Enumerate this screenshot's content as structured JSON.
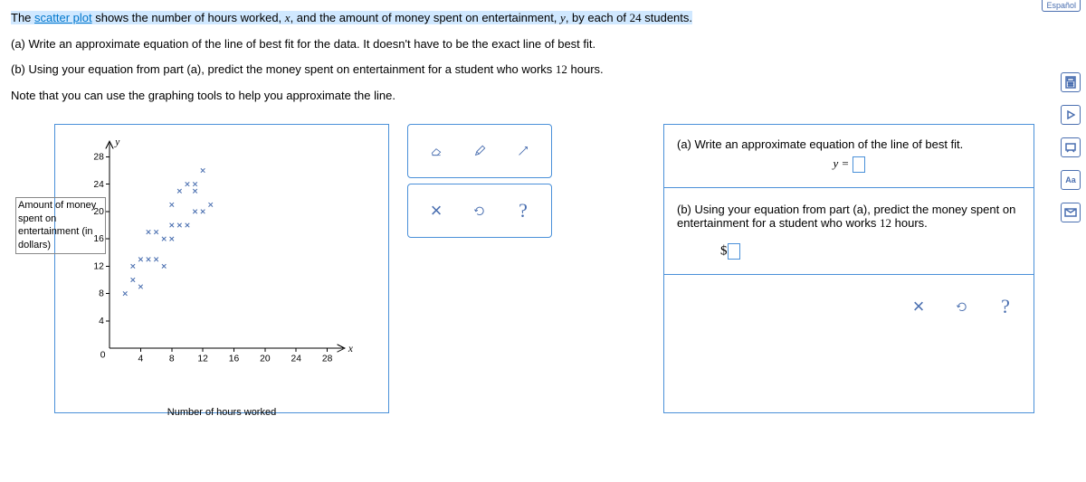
{
  "espanol": "Español",
  "question": {
    "intro_pre": "The ",
    "scatter_link": "scatter plot",
    "intro_mid1": " shows the number of hours worked, ",
    "var_x": "x",
    "intro_mid2": ", and the amount of money spent on entertainment, ",
    "var_y": "y",
    "intro_mid3": ", by each of ",
    "student_count": "24",
    "intro_end": " students.",
    "part_a": "(a) Write an approximate equation of the line of best fit for the data. It doesn't have to be the exact line of best fit.",
    "part_b_pre": "(b) Using your equation from part (a), predict the money spent on entertainment for a student who works ",
    "part_b_hours": "12",
    "part_b_post": " hours.",
    "note": "Note that you can use the graphing tools to help you approximate the line."
  },
  "chart": {
    "y_axis_name": "y",
    "x_axis_name": "x",
    "ylabel": "Amount of money spent on entertainment (in dollars)",
    "xlabel": "Number of hours worked",
    "origin": "0",
    "x_ticks": [
      "4",
      "8",
      "12",
      "16",
      "20",
      "24",
      "28"
    ],
    "y_ticks": [
      "4",
      "8",
      "12",
      "16",
      "20",
      "24",
      "28"
    ]
  },
  "chart_data": {
    "type": "scatter",
    "xlabel": "Number of hours worked",
    "ylabel": "Amount of money spent on entertainment (in dollars)",
    "xlim": [
      0,
      30
    ],
    "ylim": [
      0,
      30
    ],
    "x_ticks": [
      4,
      8,
      12,
      16,
      20,
      24,
      28
    ],
    "y_ticks": [
      4,
      8,
      12,
      16,
      20,
      24,
      28
    ],
    "points": [
      {
        "x": 2,
        "y": 8
      },
      {
        "x": 3,
        "y": 12
      },
      {
        "x": 3,
        "y": 10
      },
      {
        "x": 4,
        "y": 9
      },
      {
        "x": 4,
        "y": 13
      },
      {
        "x": 5,
        "y": 13
      },
      {
        "x": 5,
        "y": 17
      },
      {
        "x": 6,
        "y": 13
      },
      {
        "x": 6,
        "y": 17
      },
      {
        "x": 7,
        "y": 12
      },
      {
        "x": 7,
        "y": 16
      },
      {
        "x": 8,
        "y": 21
      },
      {
        "x": 8,
        "y": 18
      },
      {
        "x": 8,
        "y": 16
      },
      {
        "x": 9,
        "y": 18
      },
      {
        "x": 9,
        "y": 23
      },
      {
        "x": 10,
        "y": 24
      },
      {
        "x": 10,
        "y": 18
      },
      {
        "x": 11,
        "y": 23
      },
      {
        "x": 11,
        "y": 20
      },
      {
        "x": 11,
        "y": 24
      },
      {
        "x": 12,
        "y": 20
      },
      {
        "x": 12,
        "y": 26
      },
      {
        "x": 13,
        "y": 21
      }
    ]
  },
  "answers": {
    "a_label": "(a) Write an approximate equation of the line of best fit.",
    "a_eqn_left": "y =",
    "b_label_pre": "(b) Using your equation from part (a), predict the money spent on entertainment for a student who works ",
    "b_hours": "12",
    "b_label_post": " hours.",
    "dollar": "$"
  },
  "tools": {
    "clear": "×",
    "undo": "↺",
    "help": "?"
  },
  "rail": {
    "calc": "calculator",
    "play": "play",
    "present": "present",
    "text": "Aa",
    "mail": "mail"
  }
}
